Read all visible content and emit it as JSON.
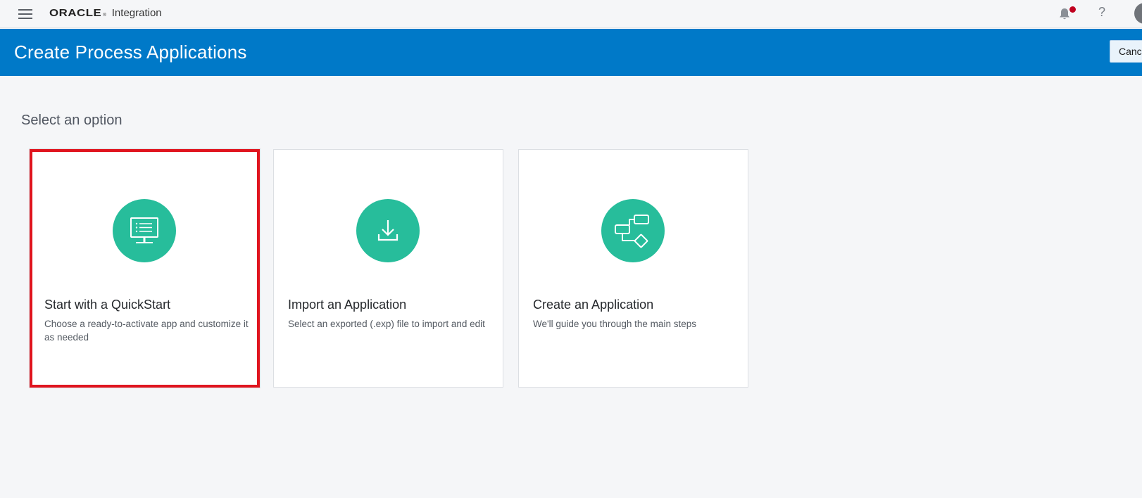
{
  "header": {
    "brand_name": "ORACLE",
    "brand_mark": "®",
    "product_name": "Integration",
    "icons": [
      "hamburger-icon",
      "bell-icon",
      "help-icon",
      "avatar"
    ],
    "help_glyph": "?",
    "notification_dot_color": "#c00020"
  },
  "banner": {
    "title": "Create Process Applications",
    "cancel_label": "Cancel",
    "background": "#0079c8"
  },
  "main": {
    "heading": "Select an option",
    "options": [
      {
        "title": "Start with a QuickStart",
        "description": "Choose a ready-to-activate app and customize it as needed",
        "icon": "monitor-icon",
        "selected": true
      },
      {
        "title": "Import an Application",
        "description": "Select an exported (.exp) file to import and edit",
        "icon": "download-icon",
        "selected": false
      },
      {
        "title": "Create an Application",
        "description": "We'll guide you through the main steps",
        "icon": "flow-diagram-icon",
        "selected": false
      }
    ],
    "icon_color": "#27bd9b",
    "selection_color": "#e0141e"
  }
}
